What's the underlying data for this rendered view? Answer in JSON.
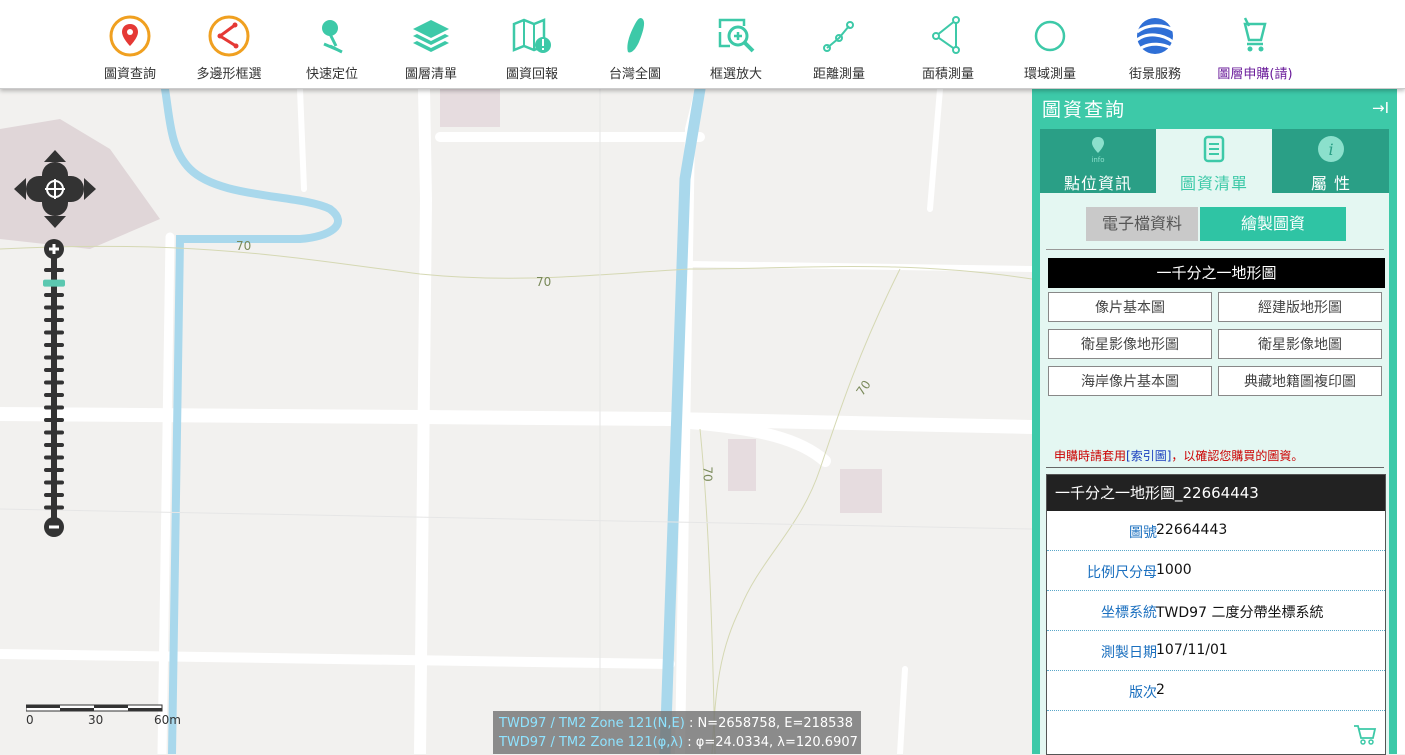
{
  "toolbar": {
    "items": [
      {
        "label": "圖資查詢",
        "icon": "map-pin-icon"
      },
      {
        "label": "多邊形框選",
        "icon": "polygon-select-icon"
      },
      {
        "label": "快速定位",
        "icon": "quick-locate-icon"
      },
      {
        "label": "圖層清單",
        "icon": "layers-icon"
      },
      {
        "label": "圖資回報",
        "icon": "map-report-icon"
      },
      {
        "label": "台灣全圖",
        "icon": "taiwan-icon"
      },
      {
        "label": "框選放大",
        "icon": "zoom-box-icon"
      },
      {
        "label": "距離測量",
        "icon": "distance-measure-icon"
      },
      {
        "label": "面積測量",
        "icon": "area-measure-icon"
      },
      {
        "label": "環域測量",
        "icon": "buffer-measure-icon"
      },
      {
        "label": "街景服務",
        "icon": "street-view-icon"
      },
      {
        "label": "圖層申購(請)",
        "icon": "cart-icon"
      }
    ]
  },
  "map": {
    "contour_labels": [
      "70",
      "70",
      "70",
      "70"
    ],
    "scale": {
      "labels": [
        "0",
        "30",
        "60m"
      ]
    },
    "coords": {
      "line1_label": "TWD97 / TM2 Zone 121(N,E)",
      "line1_value": " : N=2658758, E=218538",
      "line2_label": "TWD97 / TM2 Zone 121(φ,λ)",
      "line2_value": " : φ=24.0334, λ=120.6907"
    },
    "zoom_level_fraction": 0.93
  },
  "panel": {
    "title": "圖資查詢",
    "collapse": "→I",
    "tabs": [
      {
        "label": "點位資訊",
        "icon": "info-pin-icon"
      },
      {
        "label": "圖資清單",
        "icon": "list-icon"
      },
      {
        "label": "屬 性",
        "icon": "info-icon"
      }
    ],
    "subtabs": [
      "電子檔資料",
      "繪製圖資"
    ],
    "map_type": "一千分之一地形圖",
    "options": [
      "像片基本圖",
      "經建版地形圖",
      "衛星影像地形圖",
      "衛星影像地圖",
      "海岸像片基本圖",
      "典藏地籍圖複印圖"
    ],
    "note_before": "申購時請套用",
    "note_link": "[索引圖]",
    "note_after": "，以確認您購買的圖資。",
    "detail": {
      "title": "一千分之一地形圖_22664443",
      "rows": [
        {
          "key": "圖號",
          "value": "22664443"
        },
        {
          "key": "比例尺分母",
          "value": "1000"
        },
        {
          "key": "坐標系統",
          "value": "TWD97 二度分帶坐標系統"
        },
        {
          "key": "測製日期",
          "value": "107/11/01"
        },
        {
          "key": "版次",
          "value": "2"
        }
      ]
    }
  },
  "colors": {
    "accent": "#3dc9a8",
    "river": "#a9d8ec",
    "road": "#ffffff"
  }
}
